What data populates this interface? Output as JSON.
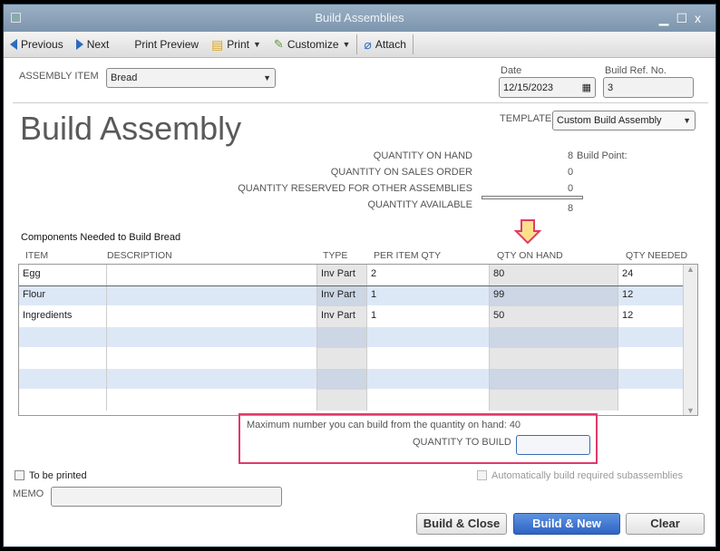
{
  "window": {
    "title": "Build Assemblies"
  },
  "toolbar": {
    "previous": "Previous",
    "next": "Next",
    "print_preview": "Print Preview",
    "print": "Print",
    "customize": "Customize",
    "attach": "Attach"
  },
  "header": {
    "assembly_item_label": "ASSEMBLY ITEM",
    "assembly_item_value": "Bread",
    "date_label": "Date",
    "date_value": "12/15/2023",
    "ref_label": "Build Ref. No.",
    "ref_value": "3",
    "template_label": "TEMPLATE",
    "template_value": "Custom Build Assembly",
    "page_title": "Build Assembly"
  },
  "quantities": {
    "on_hand_label": "QUANTITY ON HAND",
    "on_hand_value": "8",
    "build_point": "Build Point:",
    "sales_order_label": "QUANTITY ON SALES ORDER",
    "sales_order_value": "0",
    "reserved_label": "QUANTITY RESERVED FOR OTHER ASSEMBLIES",
    "reserved_value": "0",
    "available_label": "QUANTITY AVAILABLE",
    "available_value": "8"
  },
  "components": {
    "title": "Components Needed to Build  Bread",
    "columns": [
      "ITEM",
      "DESCRIPTION",
      "TYPE",
      "PER ITEM QTY",
      "QTY ON HAND",
      "QTY NEEDED"
    ],
    "rows": [
      {
        "item": "Egg",
        "description": "",
        "type": "Inv Part",
        "per_item": "2",
        "on_hand": "80",
        "needed": "24"
      },
      {
        "item": "Flour",
        "description": "",
        "type": "Inv Part",
        "per_item": "1",
        "on_hand": "99",
        "needed": "12"
      },
      {
        "item": "Ingredients",
        "description": "",
        "type": "Inv Part",
        "per_item": "1",
        "on_hand": "50",
        "needed": "12"
      }
    ]
  },
  "build": {
    "max_text": "Maximum number you can build from the quantity on hand: 40",
    "qty_label": "QUANTITY TO BUILD",
    "qty_value": ""
  },
  "footer": {
    "to_be_printed": "To be printed",
    "auto_build": "Automatically build required subassemblies",
    "memo_label": "MEMO",
    "memo_value": "",
    "build_close": "Build & Close",
    "build_new": "Build & New",
    "clear": "Clear"
  },
  "colors": {
    "accent": "#2f64c4",
    "highlight": "#e03a6a",
    "arrow_fill": "#ffe08a"
  }
}
